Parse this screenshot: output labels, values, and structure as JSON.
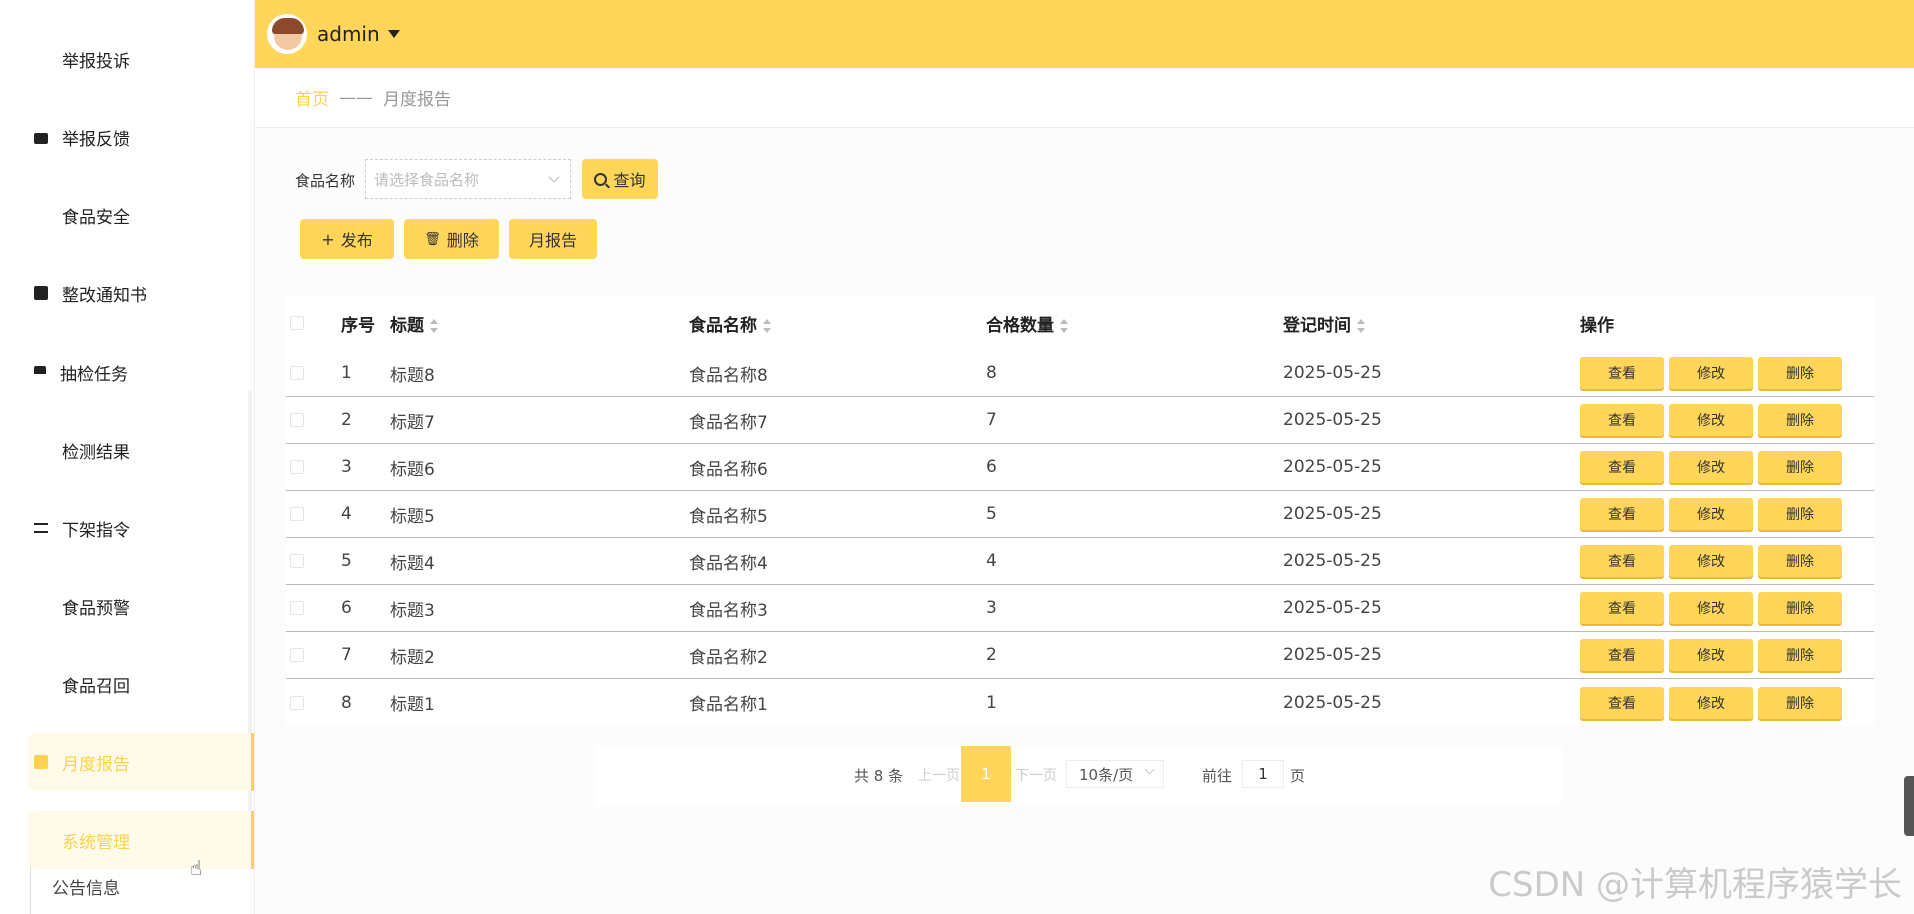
{
  "sidebar": {
    "items": [
      {
        "label": "举报投诉",
        "icon": "grid-icon"
      },
      {
        "label": "举报反馈",
        "icon": "inbox-icon"
      },
      {
        "label": "食品安全",
        "icon": "grid-icon"
      },
      {
        "label": "整改通知书",
        "icon": "clipboard-icon"
      },
      {
        "label": "抽检任务",
        "icon": "brush-icon"
      },
      {
        "label": "检测结果",
        "icon": "grid-icon"
      },
      {
        "label": "下架指令",
        "icon": "list-icon"
      },
      {
        "label": "食品预警",
        "icon": "grid-icon"
      },
      {
        "label": "食品召回",
        "icon": "grid-icon"
      },
      {
        "label": "月度报告",
        "icon": "clipboard-icon",
        "active": true
      },
      {
        "label": "系统管理",
        "icon": "grid-icon",
        "active": true
      }
    ],
    "sub_item": "公告信息"
  },
  "header": {
    "username": "admin",
    "accent_color": "#ffd55a"
  },
  "breadcrumb": {
    "home": "首页",
    "separator": "——",
    "current": "月度报告"
  },
  "search": {
    "label": "食品名称",
    "placeholder": "请选择食品名称",
    "query_button": "查询"
  },
  "toolbar": {
    "add": "发布",
    "delete": "删除",
    "report": "月报告"
  },
  "table": {
    "columns": {
      "idx": "序号",
      "title": "标题",
      "food": "食品名称",
      "qty": "合格数量",
      "date": "登记时间",
      "ops": "操作"
    },
    "actions": {
      "view": "查看",
      "edit": "修改",
      "delete": "删除"
    },
    "rows": [
      {
        "idx": "1",
        "title": "标题8",
        "food": "食品名称8",
        "qty": "8",
        "date": "2025-05-25"
      },
      {
        "idx": "2",
        "title": "标题7",
        "food": "食品名称7",
        "qty": "7",
        "date": "2025-05-25"
      },
      {
        "idx": "3",
        "title": "标题6",
        "food": "食品名称6",
        "qty": "6",
        "date": "2025-05-25"
      },
      {
        "idx": "4",
        "title": "标题5",
        "food": "食品名称5",
        "qty": "5",
        "date": "2025-05-25"
      },
      {
        "idx": "5",
        "title": "标题4",
        "food": "食品名称4",
        "qty": "4",
        "date": "2025-05-25"
      },
      {
        "idx": "6",
        "title": "标题3",
        "food": "食品名称3",
        "qty": "3",
        "date": "2025-05-25"
      },
      {
        "idx": "7",
        "title": "标题2",
        "food": "食品名称2",
        "qty": "2",
        "date": "2025-05-25"
      },
      {
        "idx": "8",
        "title": "标题1",
        "food": "食品名称1",
        "qty": "1",
        "date": "2025-05-25"
      }
    ]
  },
  "pagination": {
    "total": "共 8 条",
    "prev": "上一页",
    "current": "1",
    "next": "下一页",
    "page_size": "10条/页",
    "goto": "前往",
    "goto_value": "1",
    "page_unit": "页"
  },
  "watermark": "CSDN @计算机程序猿学长"
}
